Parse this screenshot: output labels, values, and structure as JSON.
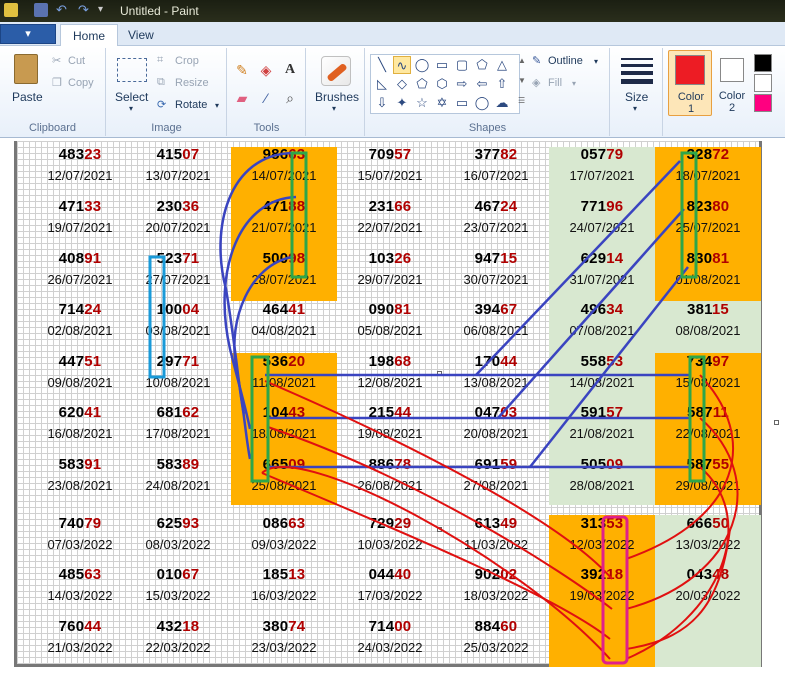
{
  "window": {
    "title": "Untitled - Paint"
  },
  "tabs": {
    "file": "▾",
    "home": "Home",
    "view": "View"
  },
  "clipboard": {
    "paste": "Paste",
    "cut": "Cut",
    "copy": "Copy",
    "label": "Clipboard"
  },
  "image": {
    "select": "Select",
    "crop": "Crop",
    "resize": "Resize",
    "rotate": "Rotate",
    "label": "Image"
  },
  "tools": {
    "label": "Tools",
    "text_glyph": "A"
  },
  "brushes": {
    "label": "Brushes"
  },
  "shapes": {
    "outline": "Outline",
    "fill": "Fill",
    "label": "Shapes"
  },
  "size": {
    "label": "Size"
  },
  "colors": {
    "color1": "Color 1",
    "color2": "Color 2",
    "color1_value": "#ed1c24",
    "color2_value": "#ffffff",
    "palette": [
      "#000000",
      "#ffffff",
      "#ff0080"
    ]
  },
  "colors_ui": {
    "orange_band": "#ffb000",
    "green_band": "#d8e8d0",
    "red_digits": "#b00000",
    "blue_lines": "#3a44c0",
    "red_lines": "#e01010",
    "green_box": "#2ea64a",
    "cyan_box": "#1a9ad8",
    "magenta_box": "#e0208a"
  },
  "grid": {
    "rows": [
      [
        {
          "lead": "483",
          "tail": "23",
          "date": "12/07/2021"
        },
        {
          "lead": "415",
          "tail": "07",
          "date": "13/07/2021"
        },
        {
          "lead": "986",
          "tail": "63",
          "date": "14/07/2021"
        },
        {
          "lead": "709",
          "tail": "57",
          "date": "15/07/2021"
        },
        {
          "lead": "377",
          "tail": "82",
          "date": "16/07/2021"
        },
        {
          "lead": "057",
          "tail": "79",
          "date": "17/07/2021"
        },
        {
          "lead": "328",
          "tail": "72",
          "date": "18/07/2021"
        }
      ],
      [
        {
          "lead": "471",
          "tail": "33",
          "date": "19/07/2021"
        },
        {
          "lead": "230",
          "tail": "36",
          "date": "20/07/2021"
        },
        {
          "lead": "471",
          "tail": "88",
          "date": "21/07/2021"
        },
        {
          "lead": "231",
          "tail": "66",
          "date": "22/07/2021"
        },
        {
          "lead": "467",
          "tail": "24",
          "date": "23/07/2021"
        },
        {
          "lead": "771",
          "tail": "96",
          "date": "24/07/2021"
        },
        {
          "lead": "823",
          "tail": "80",
          "date": "25/07/2021"
        }
      ],
      [
        {
          "lead": "408",
          "tail": "91",
          "date": "26/07/2021"
        },
        {
          "lead": "523",
          "tail": "71",
          "date": "27/07/2021"
        },
        {
          "lead": "500",
          "tail": "98",
          "date": "28/07/2021"
        },
        {
          "lead": "103",
          "tail": "26",
          "date": "29/07/2021"
        },
        {
          "lead": "947",
          "tail": "15",
          "date": "30/07/2021"
        },
        {
          "lead": "629",
          "tail": "14",
          "date": "31/07/2021"
        },
        {
          "lead": "830",
          "tail": "81",
          "date": "01/08/2021"
        }
      ],
      [
        {
          "lead": "714",
          "tail": "24",
          "date": "02/08/2021"
        },
        {
          "lead": "100",
          "tail": "04",
          "date": "03/08/2021"
        },
        {
          "lead": "464",
          "tail": "41",
          "date": "04/08/2021"
        },
        {
          "lead": "090",
          "tail": "81",
          "date": "05/08/2021"
        },
        {
          "lead": "394",
          "tail": "67",
          "date": "06/08/2021"
        },
        {
          "lead": "496",
          "tail": "34",
          "date": "07/08/2021"
        },
        {
          "lead": "381",
          "tail": "15",
          "date": "08/08/2021"
        }
      ],
      [
        {
          "lead": "447",
          "tail": "51",
          "date": "09/08/2021"
        },
        {
          "lead": "297",
          "tail": "71",
          "date": "10/08/2021"
        },
        {
          "lead": "536",
          "tail": "20",
          "date": "11/08/2021"
        },
        {
          "lead": "198",
          "tail": "68",
          "date": "12/08/2021"
        },
        {
          "lead": "170",
          "tail": "44",
          "date": "13/08/2021"
        },
        {
          "lead": "558",
          "tail": "53",
          "date": "14/08/2021"
        },
        {
          "lead": "734",
          "tail": "97",
          "date": "15/08/2021"
        }
      ],
      [
        {
          "lead": "620",
          "tail": "41",
          "date": "16/08/2021"
        },
        {
          "lead": "681",
          "tail": "62",
          "date": "17/08/2021"
        },
        {
          "lead": "104",
          "tail": "43",
          "date": "18/08/2021"
        },
        {
          "lead": "215",
          "tail": "44",
          "date": "19/08/2021"
        },
        {
          "lead": "047",
          "tail": "03",
          "date": "20/08/2021"
        },
        {
          "lead": "591",
          "tail": "57",
          "date": "21/08/2021"
        },
        {
          "lead": "587",
          "tail": "11",
          "date": "22/08/2021"
        }
      ],
      [
        {
          "lead": "583",
          "tail": "91",
          "date": "23/08/2021"
        },
        {
          "lead": "583",
          "tail": "89",
          "date": "24/08/2021"
        },
        {
          "lead": "665",
          "tail": "09",
          "date": "25/08/2021"
        },
        {
          "lead": "886",
          "tail": "78",
          "date": "26/08/2021"
        },
        {
          "lead": "691",
          "tail": "59",
          "date": "27/08/2021"
        },
        {
          "lead": "505",
          "tail": "09",
          "date": "28/08/2021"
        },
        {
          "lead": "587",
          "tail": "55",
          "date": "29/08/2021"
        }
      ],
      [
        {
          "lead": "740",
          "tail": "79",
          "date": "07/03/2022"
        },
        {
          "lead": "625",
          "tail": "93",
          "date": "08/03/2022"
        },
        {
          "lead": "086",
          "tail": "63",
          "date": "09/03/2022"
        },
        {
          "lead": "729",
          "tail": "29",
          "date": "10/03/2022"
        },
        {
          "lead": "613",
          "tail": "49",
          "date": "11/03/2022"
        },
        {
          "lead": "313",
          "tail": "53",
          "date": "12/03/2022"
        },
        {
          "lead": "666",
          "tail": "50",
          "date": "13/03/2022"
        }
      ],
      [
        {
          "lead": "485",
          "tail": "63",
          "date": "14/03/2022"
        },
        {
          "lead": "010",
          "tail": "67",
          "date": "15/03/2022"
        },
        {
          "lead": "185",
          "tail": "13",
          "date": "16/03/2022"
        },
        {
          "lead": "044",
          "tail": "40",
          "date": "17/03/2022"
        },
        {
          "lead": "902",
          "tail": "02",
          "date": "18/03/2022"
        },
        {
          "lead": "392",
          "tail": "18",
          "date": "19/03/2022"
        },
        {
          "lead": "043",
          "tail": "48",
          "date": "20/03/2022"
        }
      ],
      [
        {
          "lead": "760",
          "tail": "44",
          "date": "21/03/2022"
        },
        {
          "lead": "432",
          "tail": "18",
          "date": "22/03/2022"
        },
        {
          "lead": "380",
          "tail": "74",
          "date": "23/03/2022"
        },
        {
          "lead": "714",
          "tail": "00",
          "date": "24/03/2022"
        },
        {
          "lead": "884",
          "tail": "60",
          "date": "25/03/2022"
        }
      ]
    ]
  }
}
